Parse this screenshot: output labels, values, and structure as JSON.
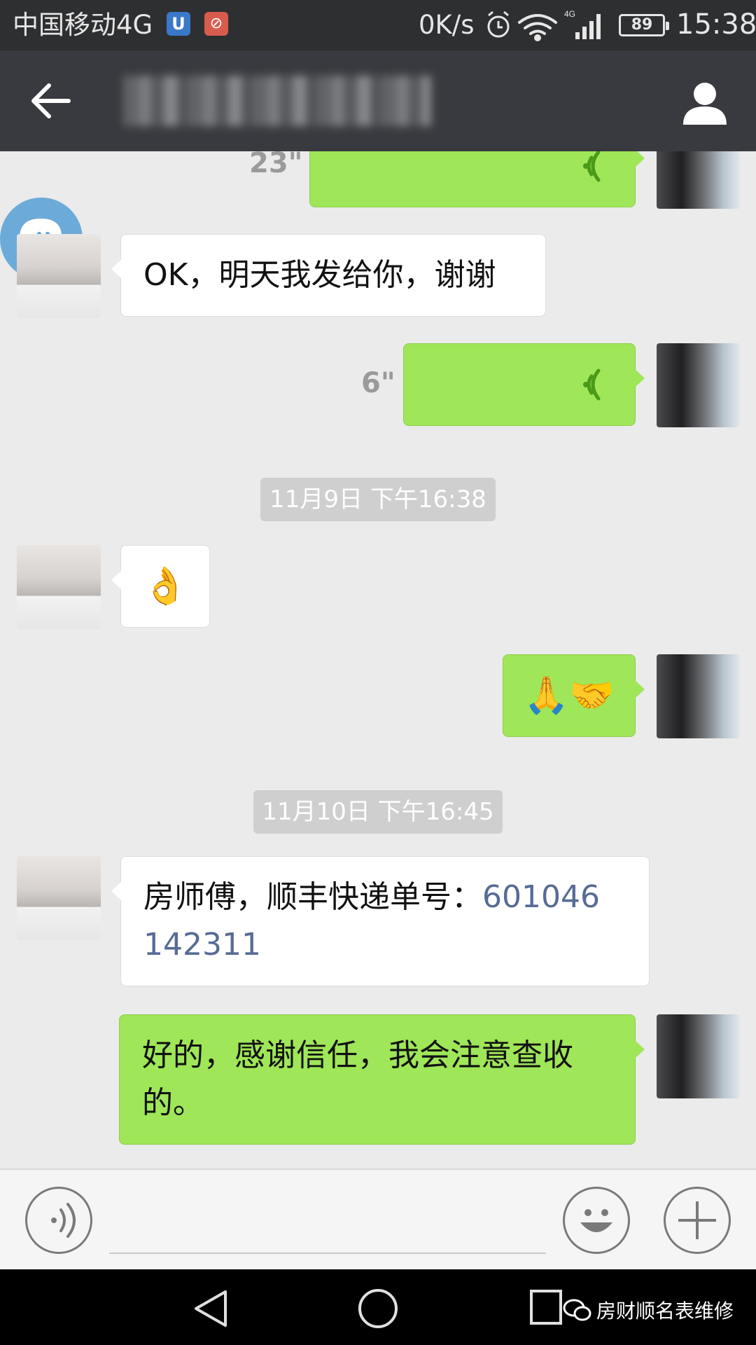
{
  "status_bar": {
    "carrier": "中国移动4G",
    "speed": "0K/s",
    "network": "4G",
    "battery": "89",
    "time": "15:38"
  },
  "header": {
    "back_icon": "arrow-left-icon",
    "profile_icon": "person-icon"
  },
  "messages": [
    {
      "type": "voice",
      "side": "me",
      "duration": "23\""
    },
    {
      "type": "text",
      "side": "other",
      "text": "OK，明天我发给你，谢谢"
    },
    {
      "type": "voice",
      "side": "me",
      "duration": "6\""
    },
    {
      "type": "timestamp",
      "text": "11月9日 下午16:38"
    },
    {
      "type": "emoji",
      "side": "other",
      "text": "👌"
    },
    {
      "type": "emoji",
      "side": "me",
      "text": "🙏🤝"
    },
    {
      "type": "timestamp",
      "text": "11月10日 下午16:45"
    },
    {
      "type": "text",
      "side": "other",
      "text": "房师傅，顺丰快递单号：",
      "tracking_part1": "601046",
      "tracking_part2": "142311"
    },
    {
      "type": "text",
      "side": "me",
      "line1": "好的，感谢信任，我会注意查收",
      "line2": "的。"
    }
  ],
  "input_bar": {
    "voice_icon": "voice-input-icon",
    "emoji_icon": "smiley-icon",
    "plus_icon": "plus-icon"
  },
  "nav_bar": {
    "watermark": "房财顺名表维修"
  },
  "colors": {
    "status_bg": "#2e2f31",
    "header_bg": "#393a3f",
    "chat_bg": "#ebebeb",
    "green_bubble": "#9fe658",
    "link": "#576b95"
  }
}
